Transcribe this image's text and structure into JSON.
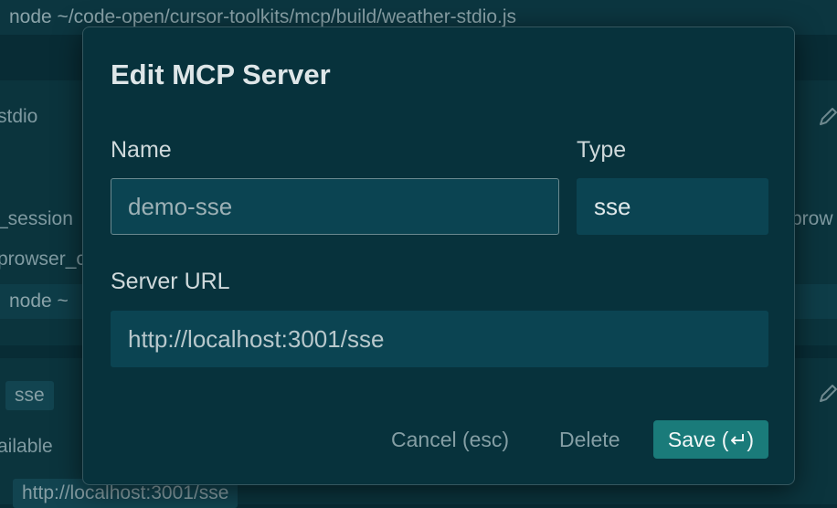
{
  "background": {
    "command_top": "node ~/code-open/cursor-toolkits/mcp/build/weather-stdio.js",
    "row_stdio": "stdio",
    "tool_session": "_session",
    "tool_browser_left": "prowser_c",
    "tool_browser_right": "prow",
    "command_mid": "node ~",
    "chip_sse": "sse",
    "status_available": "ailable",
    "url_bottom": "http://localhost:3001/sse"
  },
  "modal": {
    "title": "Edit MCP Server",
    "name_label": "Name",
    "name_value": "demo-sse",
    "type_label": "Type",
    "type_value": "sse",
    "url_label": "Server URL",
    "url_value": "http://localhost:3001/sse",
    "cancel_label": "Cancel (esc)",
    "delete_label": "Delete",
    "save_label": "Save ("
  },
  "icons": {
    "enter": "enter-icon",
    "edit": "pencil-icon"
  },
  "colors": {
    "accent": "#1a7b7a",
    "modal_bg": "#07323c",
    "input_bg": "#0b4452"
  }
}
